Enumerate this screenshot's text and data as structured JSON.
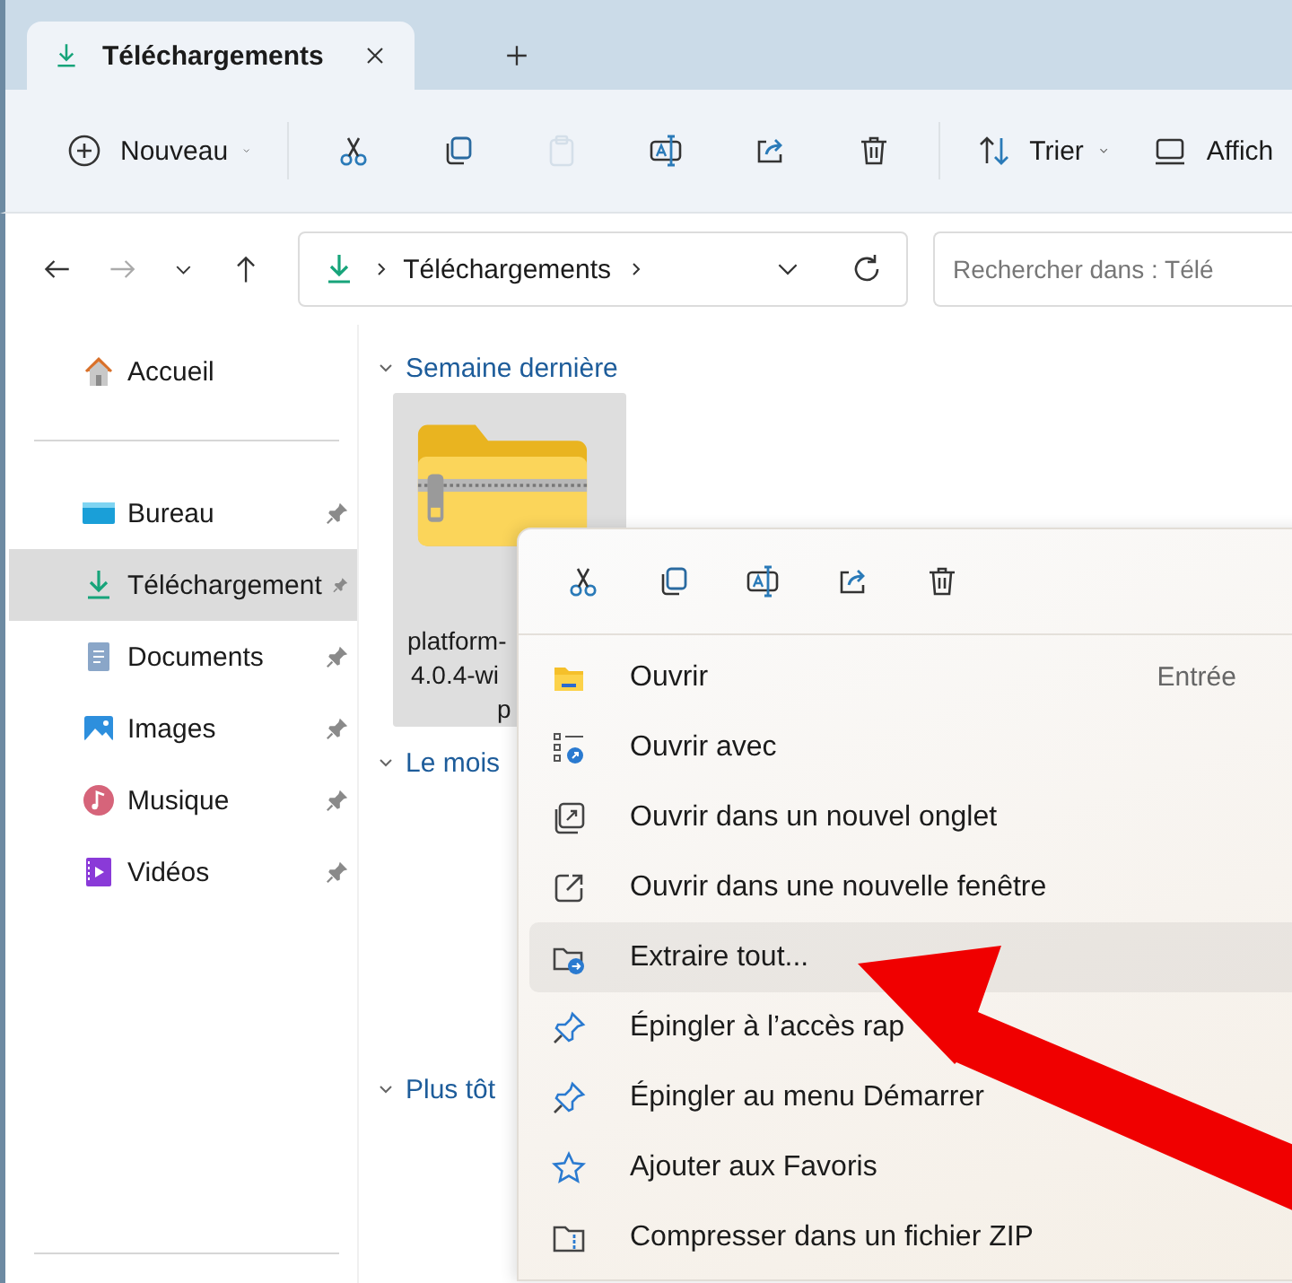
{
  "tabs": [
    {
      "label": "Téléchargements",
      "selected": true
    }
  ],
  "toolbar": [
    {
      "kind": "new",
      "label": "Nouveau",
      "disabled": false
    },
    {
      "kind": "cut",
      "disabled": false
    },
    {
      "kind": "copy",
      "disabled": false
    },
    {
      "kind": "paste",
      "disabled": true
    },
    {
      "kind": "rename",
      "disabled": false
    },
    {
      "kind": "share",
      "disabled": false
    },
    {
      "kind": "delete",
      "disabled": false
    },
    {
      "kind": "sort",
      "label": "Trier",
      "disabled": false
    },
    {
      "kind": "view",
      "label": "Affich",
      "disabled": false
    }
  ],
  "navigation": {
    "back_disabled": false,
    "forward_disabled": true
  },
  "address_bar": {
    "path": "Téléchargements"
  },
  "search": {
    "placeholder": "Rechercher dans : Télé"
  },
  "sidebar": {
    "home": {
      "kind": "home",
      "label": "Accueil"
    },
    "items": [
      {
        "kind": "desktop",
        "label": "Bureau",
        "pinned": true,
        "selected": false
      },
      {
        "kind": "download",
        "label": "Téléchargement",
        "pinned": true,
        "selected": true
      },
      {
        "kind": "documents",
        "label": "Documents",
        "pinned": true,
        "selected": false
      },
      {
        "kind": "images",
        "label": "Images",
        "pinned": true,
        "selected": false
      },
      {
        "kind": "music",
        "label": "Musique",
        "pinned": true,
        "selected": false
      },
      {
        "kind": "videos",
        "label": "Vidéos",
        "pinned": true,
        "selected": false
      }
    ]
  },
  "groups": [
    {
      "title": "Semaine dernière",
      "files": [
        {
          "name_lines": [
            "platform-",
            "4.0.4-wi",
            "p"
          ],
          "selected": true
        }
      ]
    },
    {
      "title": "Le mois"
    },
    {
      "title": "Plus tôt"
    }
  ],
  "context_menu": {
    "actions": [
      {
        "kind": "cut"
      },
      {
        "kind": "copy"
      },
      {
        "kind": "rename"
      },
      {
        "kind": "share"
      },
      {
        "kind": "delete"
      }
    ],
    "items": [
      {
        "kind": "open",
        "label": "Ouvrir",
        "shortcut": "Entrée",
        "selected": false
      },
      {
        "kind": "open-with",
        "label": "Ouvrir avec",
        "selected": false
      },
      {
        "kind": "new-tab",
        "label": "Ouvrir dans un nouvel onglet",
        "selected": false
      },
      {
        "kind": "new-window",
        "label": "Ouvrir dans une nouvelle fenêtre",
        "selected": false
      },
      {
        "kind": "extract",
        "label": "Extraire tout...",
        "selected": true
      },
      {
        "kind": "pin",
        "label": "Épingler à l’accès rap",
        "selected": false
      },
      {
        "kind": "pin",
        "label": "Épingler au menu Démarrer",
        "selected": false
      },
      {
        "kind": "star",
        "label": "Ajouter aux Favoris",
        "selected": false
      },
      {
        "kind": "zip",
        "label": "Compresser dans un fichier ZIP",
        "selected": false
      }
    ]
  }
}
